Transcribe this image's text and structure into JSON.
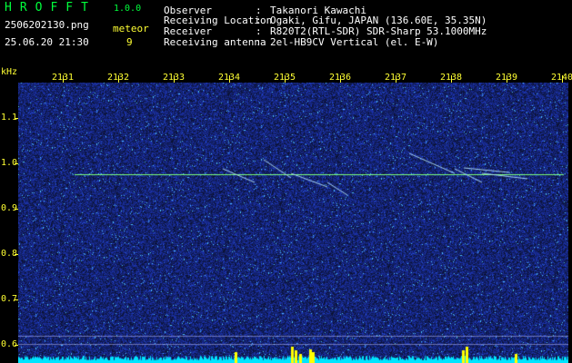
{
  "header": {
    "app_title": "HROFFT",
    "app_version": "1.0.0",
    "file_name": "2506202130.png",
    "datetime": "25.06.20 21:30",
    "meteor_label": "meteor",
    "meteor_count": "9",
    "info": [
      {
        "label": "Observer",
        "value": "Takanori Kawachi"
      },
      {
        "label": "Receiving Location",
        "value": "Ogaki, Gifu, JAPAN (136.60E, 35.35N)"
      },
      {
        "label": "Receiver",
        "value": "R820T2(RTL-SDR) SDR-Sharp 53.1000MHz"
      },
      {
        "label": "Receiving antenna",
        "value": "2el-HB9CV Vertical (el. E-W)"
      }
    ],
    "separator": ":"
  },
  "axes": {
    "y_unit": "kHz",
    "x_ticks": [
      "2131",
      "2132",
      "2133",
      "2134",
      "2135",
      "2136",
      "2137",
      "2138",
      "2139",
      "2140"
    ],
    "y_ticks": [
      "1.1",
      "1.0",
      "0.9",
      "0.8",
      "0.7",
      "0.6"
    ]
  },
  "colors": {
    "background": "#000000",
    "noise": "#1a2bd0",
    "carrier": "#7cff7c",
    "baseline": "#00e5ff",
    "burst": "#ffff00",
    "text_green": "#00ff3c",
    "text_yellow": "#ffff33"
  }
}
